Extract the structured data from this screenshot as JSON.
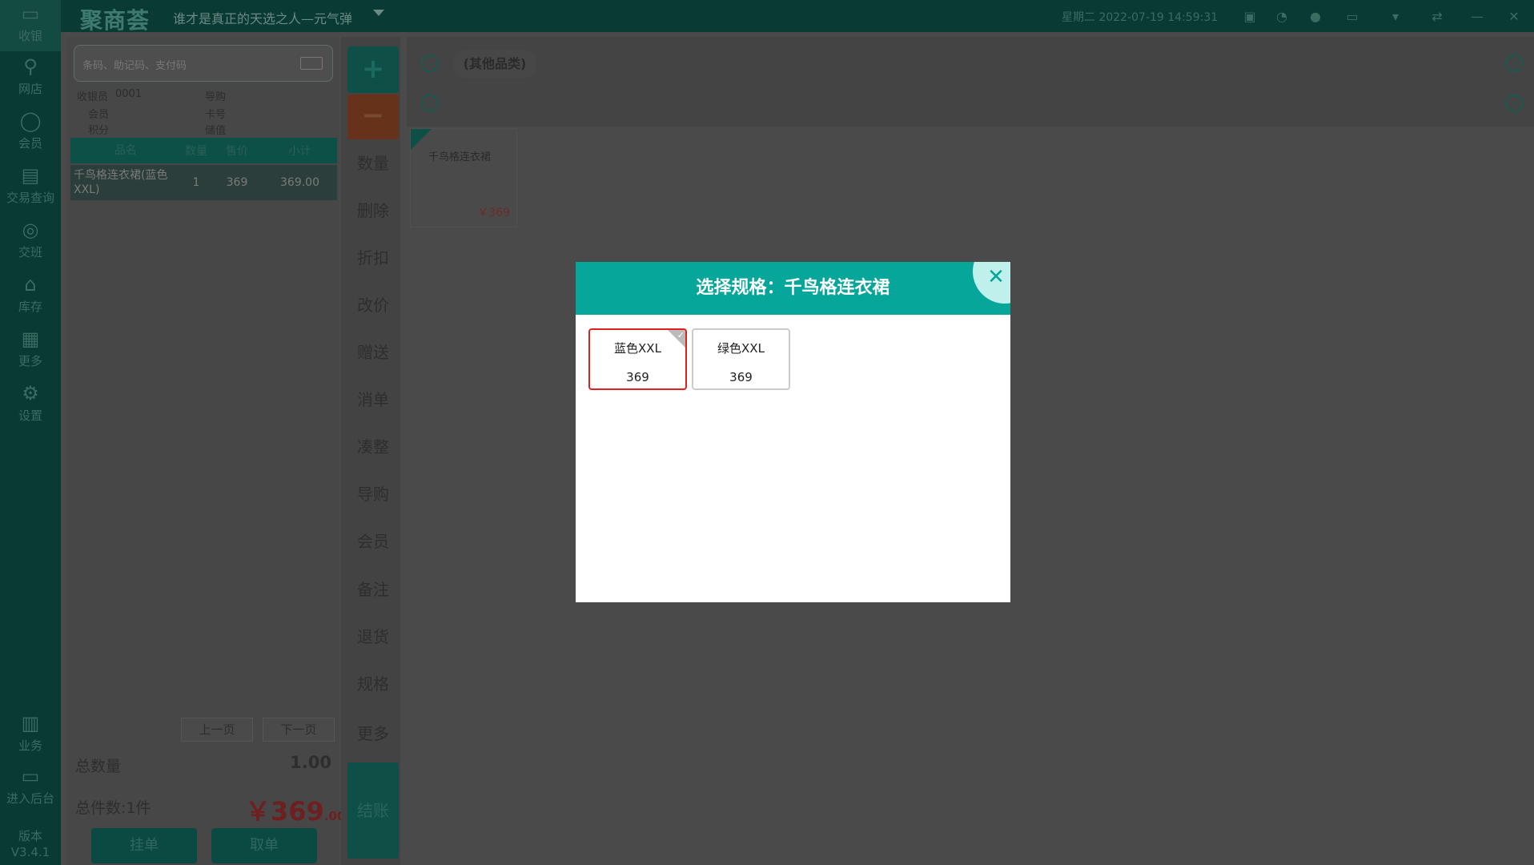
{
  "topbar": {
    "brand": "聚商荟",
    "slogan": "谁才是真正的天选之人—元气弹",
    "datetime": "星期二 2022-07-19 14:59:31"
  },
  "sidebar": {
    "items": [
      {
        "label": "收银",
        "icon": "monitor-icon"
      },
      {
        "label": "网店",
        "icon": "bike-icon"
      },
      {
        "label": "会员",
        "icon": "user-icon"
      },
      {
        "label": "交易查询",
        "icon": "document-icon"
      },
      {
        "label": "交班",
        "icon": "handover-icon"
      },
      {
        "label": "库存",
        "icon": "home-icon"
      },
      {
        "label": "更多",
        "icon": "grid-icon"
      },
      {
        "label": "设置",
        "icon": "gear-icon"
      },
      {
        "label": "业务",
        "icon": "book-icon"
      },
      {
        "label": "进入后台",
        "icon": "monitor-icon"
      }
    ],
    "version_label": "版本",
    "version": "V3.4.1"
  },
  "order": {
    "search_placeholder": "条码、助记码、支付码",
    "cashier_label": "收银员",
    "cashier_value": "0001",
    "guide_label": "导购",
    "member_label": "会员",
    "card_label": "卡号",
    "points_label": "积分",
    "balance_label": "储值",
    "columns": [
      "品名",
      "数量",
      "售价",
      "小计"
    ],
    "rows": [
      {
        "name": "千鸟格连衣裙(蓝色XXL)",
        "qty": "1",
        "price": "369",
        "subtotal": "369.00"
      }
    ],
    "prev_page": "上一页",
    "next_page": "下一页",
    "total_qty_label": "总数量",
    "total_qty": "1.00",
    "total_items_label": "总件数:1件",
    "total_price_int": "￥369",
    "total_price_dec": ".00",
    "hold_button": "挂单",
    "retrieve_button": "取单"
  },
  "functions": {
    "plus": "+",
    "minus": "−",
    "items": [
      "数量",
      "删除",
      "折扣",
      "改价",
      "赠送",
      "消单",
      "凑整",
      "导购",
      "会员",
      "备注",
      "退货",
      "规格",
      "更多"
    ],
    "checkout": "结账"
  },
  "catalog": {
    "category_tab": "(其他品类)",
    "product_name": "千鸟格连衣裙",
    "product_price": "￥369"
  },
  "modal": {
    "title": "选择规格：千鸟格连衣裙",
    "close": "✕",
    "specs": [
      {
        "name": "蓝色XXL",
        "price": "369",
        "selected": true
      },
      {
        "name": "绿色XXL",
        "price": "369",
        "selected": false
      }
    ]
  },
  "colors": {
    "modal_header": "#06a69a",
    "selected_border": "#e02020",
    "sidebar_bg": "#0a3a34"
  }
}
